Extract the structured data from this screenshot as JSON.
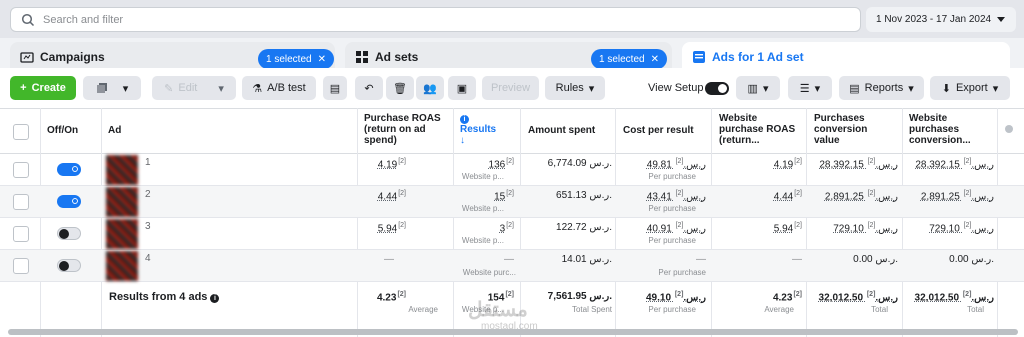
{
  "search": {
    "placeholder": "Search and filter"
  },
  "date_range": "1 Nov 2023 - 17 Jan 2024",
  "tabs": [
    {
      "label": "Campaigns",
      "selected": "1 selected"
    },
    {
      "label": "Ad sets",
      "selected": "1 selected"
    },
    {
      "label": "Ads for 1 Ad set"
    }
  ],
  "toolbar": {
    "create": "Create",
    "edit": "Edit",
    "ab_test": "A/B test",
    "preview": "Preview",
    "rules": "Rules",
    "view_setup": "View Setup",
    "reports": "Reports",
    "export": "Export"
  },
  "columns": {
    "off_on": "Off/On",
    "ad": "Ad",
    "roas": "Purchase ROAS (return on ad spend)",
    "results": "Results",
    "amount": "Amount spent",
    "cpr": "Cost per result",
    "web_roas": "Website purchase ROAS (return...",
    "conv_value": "Purchases conversion value",
    "web_conv": "Website purchases conversion..."
  },
  "sup": "[2]",
  "rows": [
    {
      "idx": "1",
      "on": true,
      "roas": "4.19",
      "results": "136",
      "results_sub": "Website p...",
      "amount": "6,774.09 ر.س.",
      "cpr": "49.81 ر.س.",
      "cpr_sub": "Per purchase",
      "web_roas": "4.19",
      "conv": "28,392.15 ر.س.",
      "web_conv": "28,392.15 ر.س."
    },
    {
      "idx": "2",
      "on": true,
      "roas": "4.44",
      "results": "15",
      "results_sub": "Website p...",
      "amount": "651.13 ر.س.",
      "cpr": "43.41 ر.س.",
      "cpr_sub": "Per purchase",
      "web_roas": "4.44",
      "conv": "2,891.25 ر.س.",
      "web_conv": "2,891.25 ر.س."
    },
    {
      "idx": "3",
      "on": false,
      "roas": "5.94",
      "results": "3",
      "results_sub": "Website p...",
      "amount": "122.72 ر.س.",
      "cpr": "40.91 ر.س.",
      "cpr_sub": "Per purchase",
      "web_roas": "5.94",
      "conv": "729.10 ر.س.",
      "web_conv": "729.10 ر.س."
    },
    {
      "idx": "4",
      "on": false,
      "roas": "—",
      "results": "—",
      "results_sub": "Website purc...",
      "amount": "14.01 ر.س.",
      "cpr": "—",
      "cpr_sub": "Per purchase",
      "web_roas": "—",
      "conv": "0.00 ر.س.",
      "web_conv": "0.00 ر.س."
    }
  ],
  "footer": {
    "label": "Results from 4 ads",
    "roas": "4.23",
    "roas_sub": "Average",
    "results": "154",
    "results_sub": "Website p...",
    "amount": "7,561.95 ر.س.",
    "amount_sub": "Total Spent",
    "cpr": "49.10 ر.س.",
    "cpr_sub": "Per purchase",
    "web_roas": "4.23",
    "web_roas_sub": "Average",
    "conv": "32,012.50 ر.س.",
    "conv_sub": "Total",
    "web_conv": "32,012.50 ر.س.",
    "web_conv_sub": "Total"
  },
  "watermark": {
    "main": "مستقل",
    "sub": "mostaql.com"
  }
}
